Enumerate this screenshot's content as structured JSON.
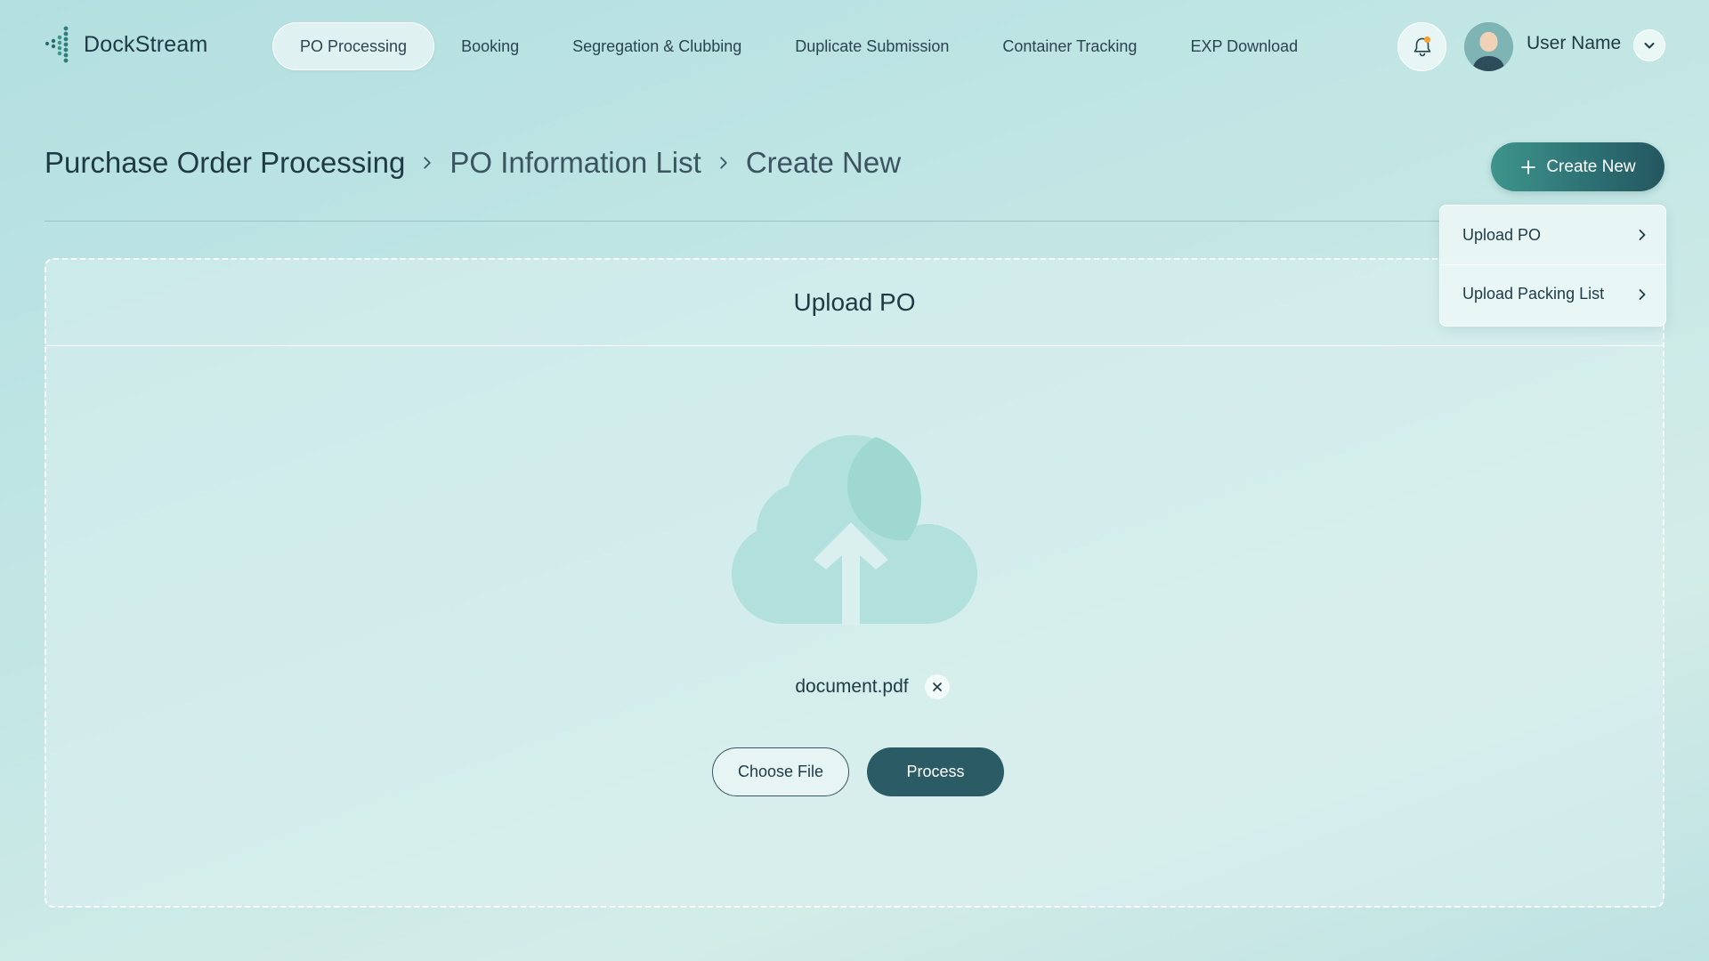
{
  "app": {
    "brand": "DockStream"
  },
  "nav": {
    "items": [
      {
        "label": "PO Processing",
        "active": true
      },
      {
        "label": "Booking",
        "active": false
      },
      {
        "label": "Segregation & Clubbing",
        "active": false
      },
      {
        "label": "Duplicate Submission",
        "active": false
      },
      {
        "label": "Container Tracking",
        "active": false
      },
      {
        "label": "EXP Download",
        "active": false
      }
    ]
  },
  "user": {
    "name": "User Name",
    "has_notification": true,
    "notification_color": "#f4a236"
  },
  "breadcrumb": {
    "root": "Purchase Order Processing",
    "items": [
      "PO Information List",
      "Create New"
    ]
  },
  "actions": {
    "create_new_label": "Create New"
  },
  "dropdown": {
    "items": [
      {
        "label": "Upload PO",
        "icon": "chevron-right-icon"
      },
      {
        "label": "Upload Packing List",
        "icon": "chevron-right-icon"
      }
    ]
  },
  "upload": {
    "title": "Upload PO",
    "icon": "cloud-upload-icon",
    "file_name": "document.pdf",
    "choose_label": "Choose File",
    "process_label": "Process"
  },
  "colors": {
    "primary": "#2b5c65",
    "accent": "#3e958d",
    "cloud": "#b2e0dc"
  }
}
